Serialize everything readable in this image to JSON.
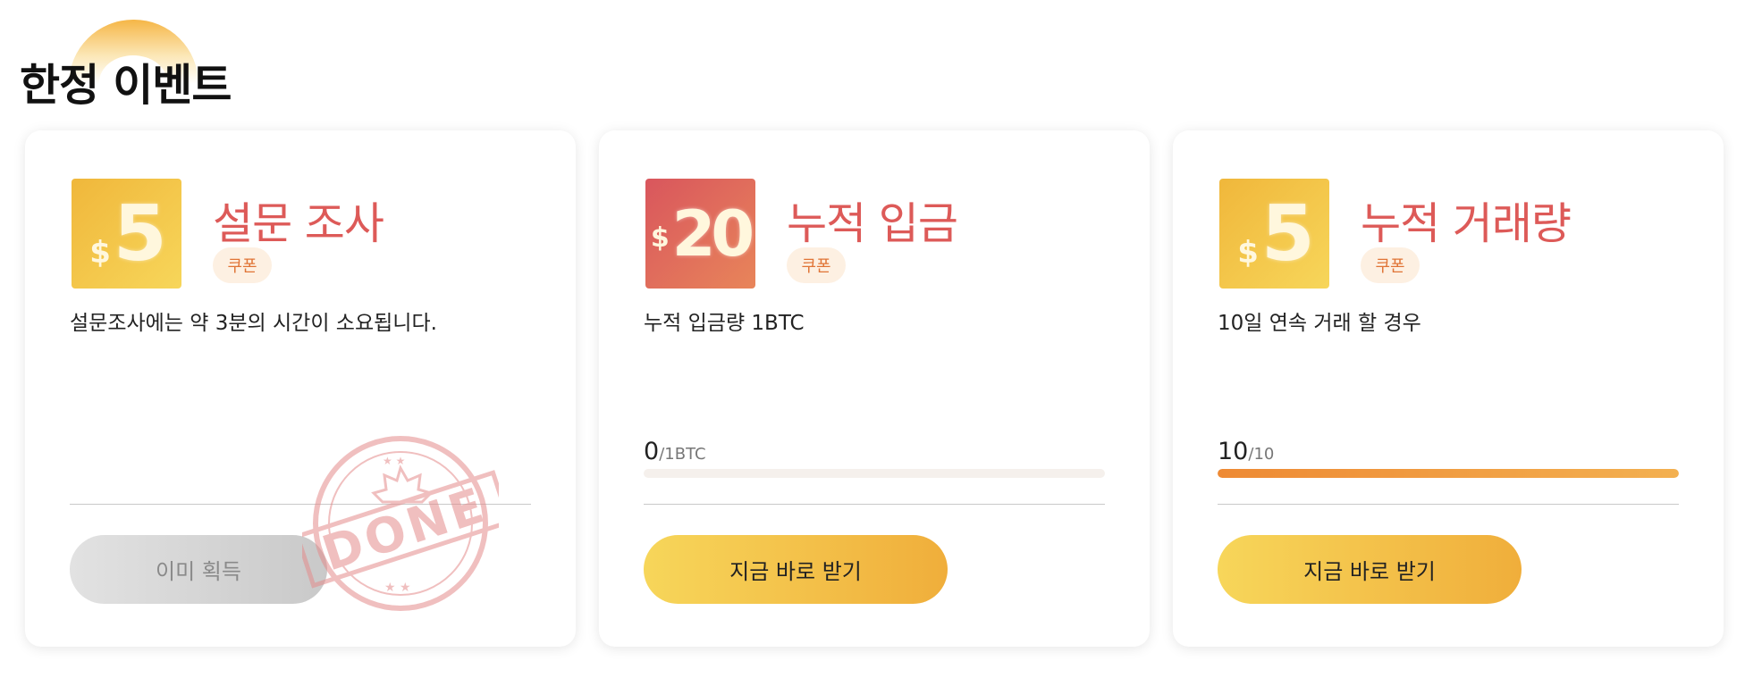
{
  "section": {
    "title": "한정 이벤트"
  },
  "cards": [
    {
      "badge": {
        "currency": "$",
        "amount": "5",
        "color": "gold"
      },
      "title": "설문 조사",
      "tag": "쿠폰",
      "description": "설문조사에는 약 3분의 시간이 소요됩니다.",
      "button": {
        "label": "이미 획득",
        "state": "disabled"
      },
      "stamp": "DONE"
    },
    {
      "badge": {
        "currency": "$",
        "amount": "20",
        "color": "red"
      },
      "title": "누적 입금",
      "tag": "쿠폰",
      "description": "누적 입금량 1BTC",
      "progress": {
        "current": "0",
        "separator": "/",
        "target": "1BTC",
        "fraction": 0.0
      },
      "button": {
        "label": "지금 바로 받기",
        "state": "active"
      }
    },
    {
      "badge": {
        "currency": "$",
        "amount": "5",
        "color": "gold"
      },
      "title": "누적 거래량",
      "tag": "쿠폰",
      "description": "10일 연속 거래 할 경우",
      "progress": {
        "current": "10",
        "separator": "/",
        "target": "10",
        "fraction": 1.0
      },
      "button": {
        "label": "지금 바로 받기",
        "state": "active"
      }
    }
  ],
  "colors": {
    "accent_red": "#dd5a58",
    "accent_gold": "#f0ae3b",
    "tag_text": "#e07436",
    "progress_fill": "#ee8a34"
  }
}
